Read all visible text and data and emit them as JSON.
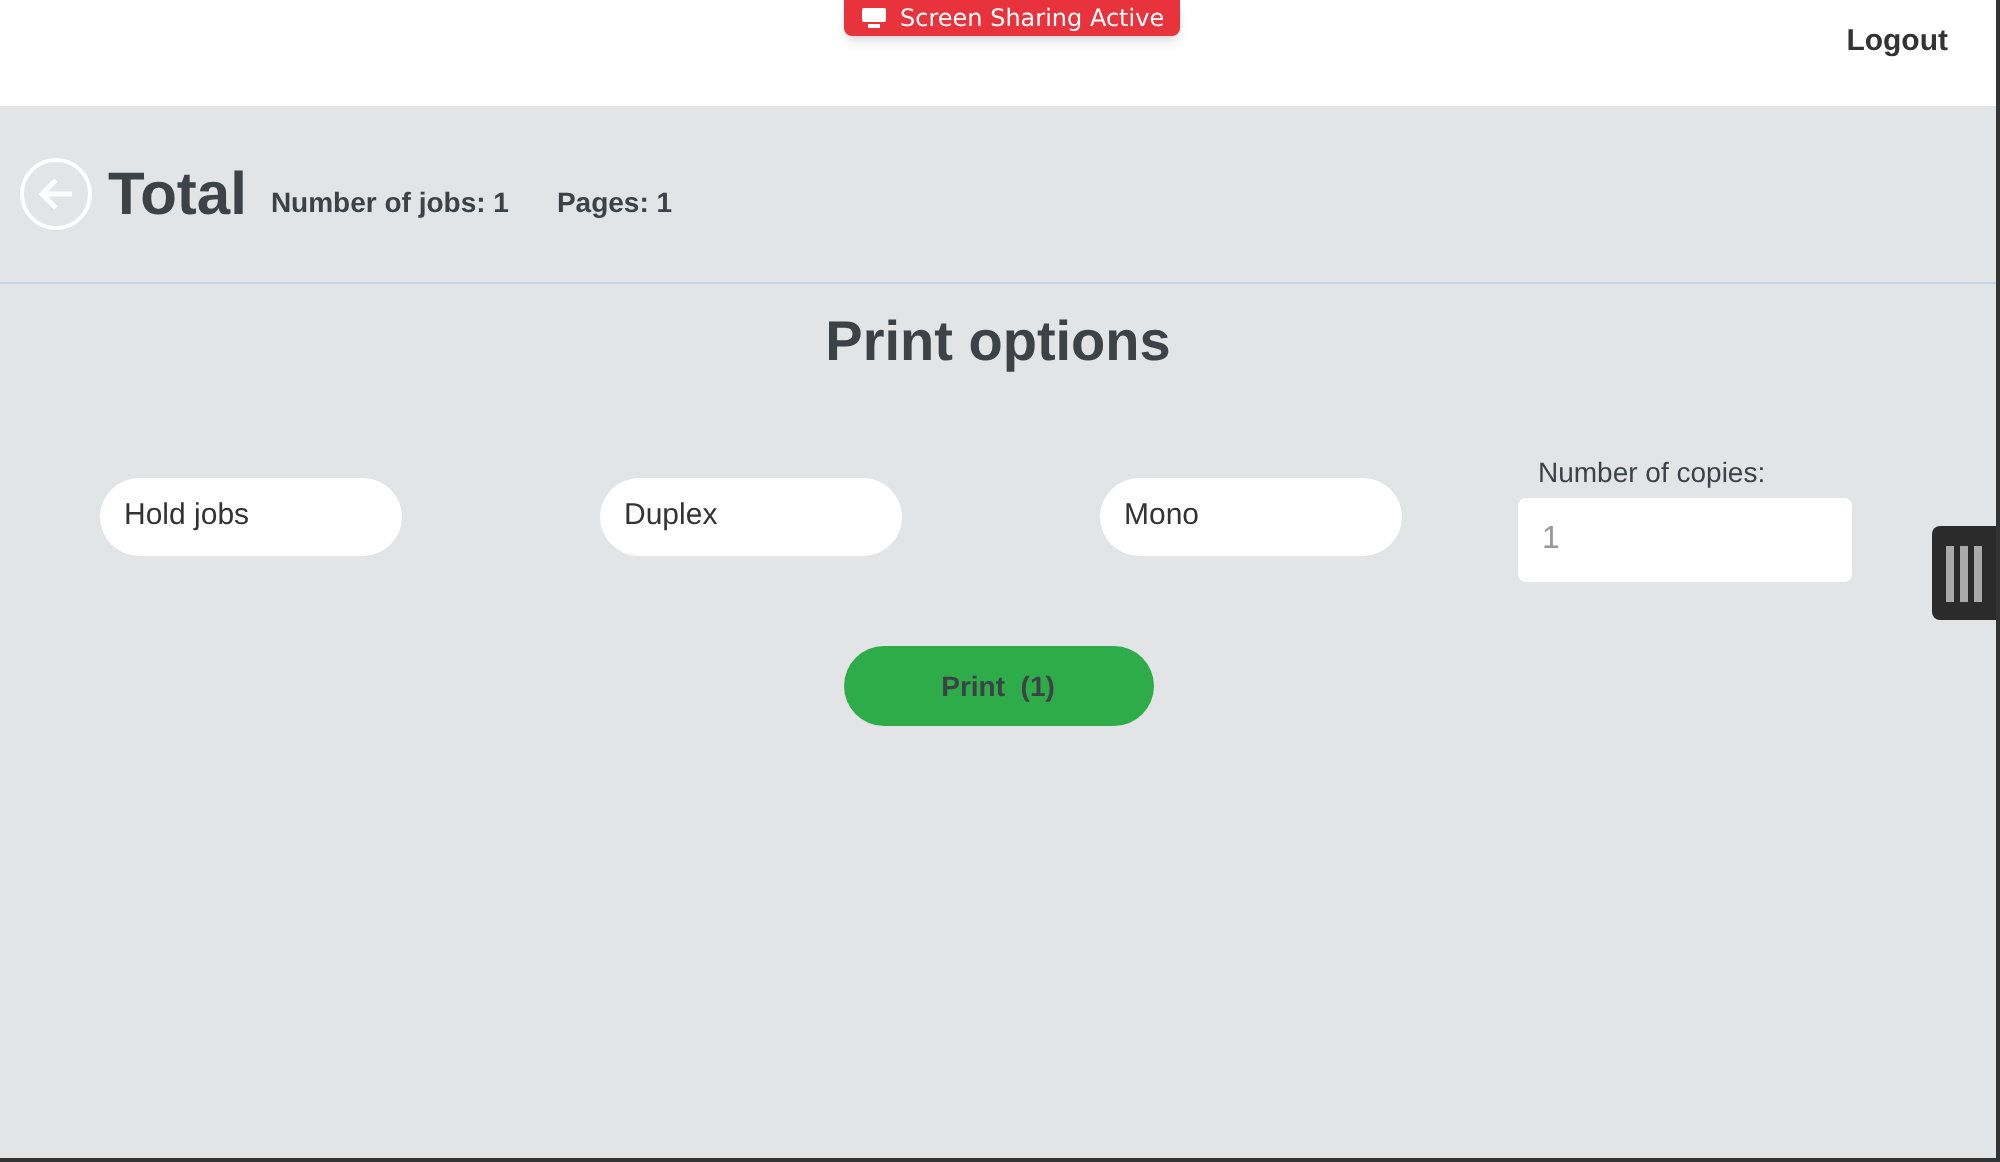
{
  "sharing_badge": "Screen Sharing Active",
  "header": {
    "logout": "Logout"
  },
  "summary": {
    "title": "Total",
    "jobs": "Number of jobs: 1",
    "pages": "Pages: 1"
  },
  "print_options": {
    "title": "Print options",
    "options": [
      {
        "label": "Hold jobs"
      },
      {
        "label": "Duplex"
      },
      {
        "label": "Mono"
      }
    ],
    "copies": {
      "label": "Number of copies:",
      "placeholder": "1"
    },
    "print_button": "Print  (1)"
  }
}
